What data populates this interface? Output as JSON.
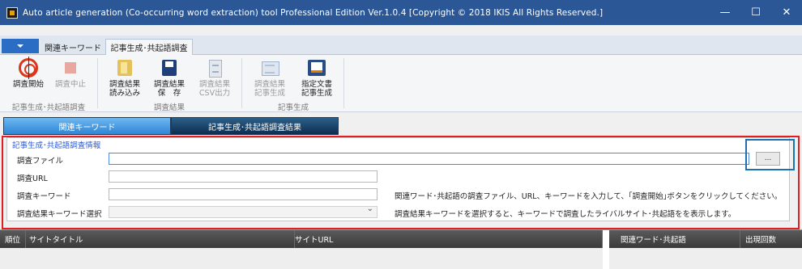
{
  "window": {
    "title": "Auto article generation (Co-occurring word extraction) tool Professional Edition Ver.1.0.4 [Copyright © 2018 IKIS All Rights Reserved.]",
    "buttons": {
      "minimize": "—",
      "maximize": "☐",
      "close": "✕"
    }
  },
  "ribbon_tabs": [
    {
      "label": "関連キーワード",
      "active": false
    },
    {
      "label": "記事生成･共起語調査",
      "active": true
    }
  ],
  "ribbon": {
    "groups": [
      {
        "label": "記事生成･共起語調査"
      },
      {
        "label": "調査結果"
      },
      {
        "label": "記事生成"
      }
    ],
    "buttons": [
      {
        "icon": "target-icon",
        "line1": "調査開始",
        "line2": "",
        "enabled": true
      },
      {
        "icon": "stop-icon",
        "line1": "調査中止",
        "line2": "",
        "enabled": false
      },
      {
        "icon": "folder-open-icon",
        "line1": "調査結果",
        "line2": "読み込み",
        "enabled": true
      },
      {
        "icon": "save-icon",
        "line1": "調査結果",
        "line2": "保　存",
        "enabled": true
      },
      {
        "icon": "csv-export-icon",
        "line1": "調査結果",
        "line2": "CSV出力",
        "enabled": false
      },
      {
        "icon": "article-generate-icon",
        "line1": "調査結果",
        "line2": "記事生成",
        "enabled": false
      },
      {
        "icon": "document-generate-icon",
        "line1": "指定文書",
        "line2": "記事生成",
        "enabled": true
      }
    ]
  },
  "subtabs": [
    {
      "label": "関連キーワード"
    },
    {
      "label": "記事生成･共起語調査結果"
    }
  ],
  "panel": {
    "title": "記事生成･共起語調査情報",
    "fields": [
      {
        "label": "調査ファイル",
        "value": ""
      },
      {
        "label": "調査URL",
        "value": ""
      },
      {
        "label": "調査キーワード",
        "value": ""
      },
      {
        "label": "調査結果キーワード選択",
        "value": ""
      }
    ],
    "browse_label": "...",
    "hint_keyword": "関連ワード･共起語の調査ファイル、URL、キーワードを入力して、｢調査開始｣ボタンをクリックしてください。",
    "hint_select": "調査結果キーワードを選択すると、キーワードで調査したライバルサイト･共起語をを表示します。"
  },
  "grid": {
    "left_columns": [
      "順位",
      "サイトタイトル",
      "サイトURL"
    ],
    "right_columns": [
      "関連ワード･共起語",
      "出現回数"
    ]
  },
  "colors": {
    "titlebar": "#2b5797",
    "highlight_red": "#e02020",
    "highlight_blue": "#1f6fb4",
    "panel_title": "#2a5bd7"
  }
}
